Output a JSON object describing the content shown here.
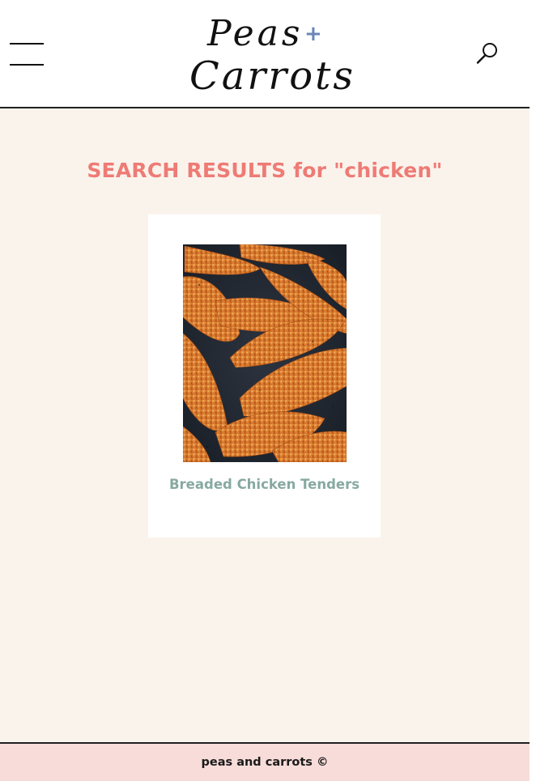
{
  "header": {
    "logo_line1": "Peas",
    "logo_plus": "+",
    "logo_line2": "Carrots",
    "menu_icon": "hamburger-menu-icon",
    "search_icon": "search-icon"
  },
  "main": {
    "results_title": "SEARCH RESULTS for \"chicken\"",
    "results": [
      {
        "title": "Breaded Chicken Tenders",
        "image": "breaded-chicken-tenders-photo"
      }
    ]
  },
  "footer": {
    "text": "peas and carrots ©"
  },
  "colors": {
    "page_background": "#faf3ec",
    "header_background": "#ffffff",
    "title_accent": "#ee7b75",
    "card_title": "#87a9a0",
    "footer_background": "#f8dcd9",
    "logo_plus": "#6b86b8"
  }
}
